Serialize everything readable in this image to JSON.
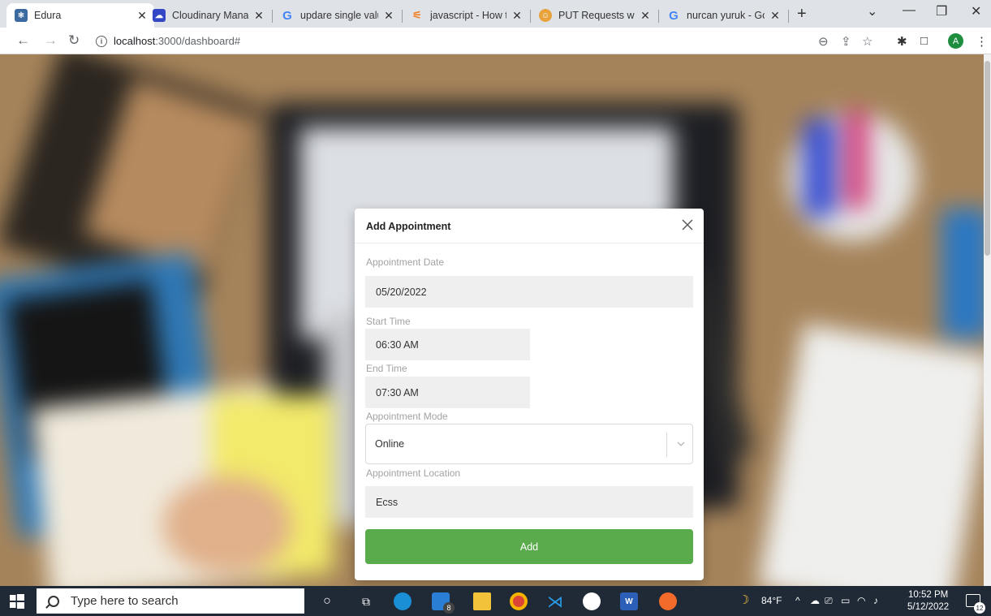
{
  "browser": {
    "tabs": [
      {
        "title": "Edura",
        "active": true,
        "icon": "react-icon",
        "icon_color": "#3b6aa0"
      },
      {
        "title": "Cloudinary Manage",
        "active": false,
        "icon": "cloudinary-icon",
        "icon_color": "#3448c5"
      },
      {
        "title": "updare single value",
        "active": false,
        "icon": "google-icon",
        "icon_color": "#4285f4"
      },
      {
        "title": "javascript - How to",
        "active": false,
        "icon": "stackoverflow-icon",
        "icon_color": "#f48024"
      },
      {
        "title": "PUT Requests with",
        "active": false,
        "icon": "page-icon",
        "icon_color": "#e8a33d"
      },
      {
        "title": "nurcan yuruk - Goo",
        "active": false,
        "icon": "google-icon",
        "icon_color": "#4285f4"
      }
    ],
    "new_tab_glyph": "+",
    "url_host": "localhost",
    "url_path": ":3000/dashboard#",
    "profile_initial": "A",
    "profile_color": "#1e8e3e"
  },
  "modal": {
    "title": "Add Appointment",
    "fields": {
      "date_label": "Appointment Date",
      "date_value": "05/20/2022",
      "start_label": "Start Time",
      "start_value": "06:30 AM",
      "end_label": "End Time",
      "end_value": "07:30 AM",
      "mode_label": "Appointment Mode",
      "mode_value": "Online",
      "location_label": "Appointment Location",
      "location_value": "Ecss"
    },
    "submit_label": "Add",
    "submit_color": "#5aab4c"
  },
  "taskbar": {
    "search_placeholder": "Type here to search",
    "mail_badge": "8",
    "weather": "84°F",
    "time": "10:52 PM",
    "date": "5/12/2022",
    "notification_count": "12"
  }
}
